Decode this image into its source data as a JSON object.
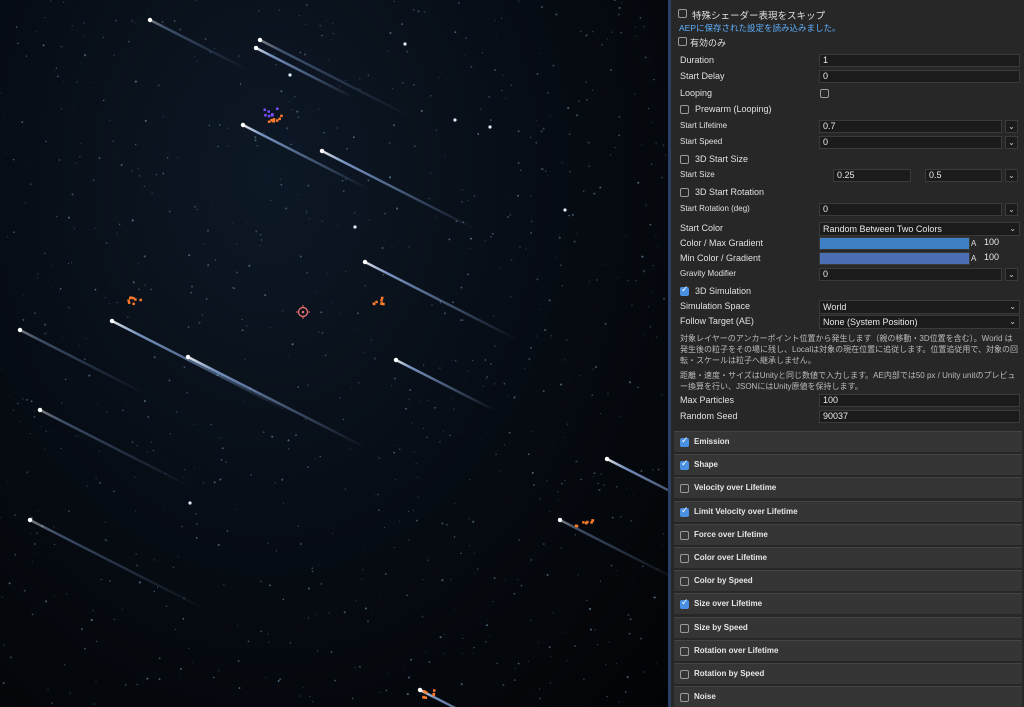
{
  "viewport": {
    "scene_name": "particle-starfield",
    "colors": {
      "streak": "#9fc3ff",
      "spark_orange": "#ff7a2a",
      "spark_purple": "#7a4cff",
      "gizmo": "#e06a6a"
    }
  },
  "panel": {
    "skip_shader": {
      "label": "特殊シェーダー表現をスキップ",
      "checked": false
    },
    "notice": "AEPに保存された設定を読み込みました。",
    "active_only": {
      "label": "有効のみ",
      "checked": false
    },
    "duration": {
      "label": "Duration",
      "value": "1"
    },
    "start_delay": {
      "label": "Start Delay",
      "value": "0"
    },
    "looping": {
      "label": "Looping",
      "checked": false
    },
    "prewarm": {
      "label": "Prewarm (Looping)",
      "checked": false
    },
    "start_lifetime": {
      "label": "Start Lifetime",
      "value": "0.7"
    },
    "start_speed": {
      "label": "Start Speed",
      "value": "0"
    },
    "start_size_3d": {
      "label": "3D Start Size",
      "checked": false
    },
    "start_size": {
      "label": "Start Size",
      "min": "0.25",
      "max": "0.5"
    },
    "start_rotation_3d": {
      "label": "3D Start Rotation",
      "checked": false
    },
    "start_rotation": {
      "label": "Start Rotation (deg)",
      "value": "0"
    },
    "start_color": {
      "label": "Start Color",
      "value": "Random Between Two Colors"
    },
    "color_max": {
      "label": "Color / Max Gradient",
      "alpha_label": "A",
      "alpha": "100",
      "color": "#3d7fc4"
    },
    "color_min": {
      "label": "Min Color / Gradient",
      "alpha_label": "A",
      "alpha": "100",
      "color": "#4a6fb5"
    },
    "gravity": {
      "label": "Gravity Modifier",
      "value": "0"
    },
    "sim_3d": {
      "label": "3D Simulation",
      "checked": true
    },
    "simulation_space": {
      "label": "Simulation Space",
      "value": "World"
    },
    "follow_target": {
      "label": "Follow Target (AE)",
      "value": "None (System Position)"
    },
    "note1": "対象レイヤーのアンカーポイント位置から発生します（親の移動・3D位置を含む）。World は発生後の粒子をその場に残し、Localは対象の現在位置に追従します。位置追従用で、対象の回転・スケールは粒子へ継承しません。",
    "note2": "距離・速度・サイズはUnityと同じ数値で入力します。AE内部では50 px / Unity unitのプレビュー換算を行い、JSONにはUnity原値を保持します。",
    "max_particles": {
      "label": "Max Particles",
      "value": "100"
    },
    "random_seed": {
      "label": "Random Seed",
      "value": "90037"
    },
    "modules": [
      {
        "label": "Emission",
        "checked": true
      },
      {
        "label": "Shape",
        "checked": true
      },
      {
        "label": "Velocity over Lifetime",
        "checked": false
      },
      {
        "label": "Limit Velocity over Lifetime",
        "checked": true
      },
      {
        "label": "Force over Lifetime",
        "checked": false
      },
      {
        "label": "Color over Lifetime",
        "checked": false
      },
      {
        "label": "Color by Speed",
        "checked": false
      },
      {
        "label": "Size over Lifetime",
        "checked": true
      },
      {
        "label": "Size by Speed",
        "checked": false
      },
      {
        "label": "Rotation over Lifetime",
        "checked": false
      },
      {
        "label": "Rotation by Speed",
        "checked": false
      },
      {
        "label": "Noise",
        "checked": false
      }
    ]
  }
}
